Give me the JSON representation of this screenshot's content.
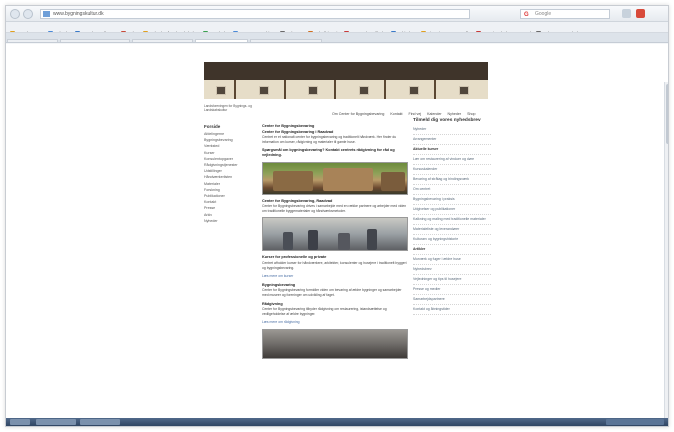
{
  "browser": {
    "url": "www.bygningskultur.dk",
    "search_placeholder": "Google",
    "search_logo": "G"
  },
  "bookmarks": [
    {
      "label": "Mest besøgte",
      "color": "#e0a020"
    },
    {
      "label": "Nyheder",
      "color": "#4a8ad8"
    },
    {
      "label": "Danske-ordbøger",
      "color": "#3a7ac8"
    },
    {
      "label": "Kultur",
      "color": "#c84a3a"
    },
    {
      "label": "Nyheder fra dansk kultur",
      "color": "#e0a020"
    },
    {
      "label": "Bornholm",
      "color": "#3aa050"
    },
    {
      "label": "Museer og Arkiver",
      "color": "#4a8ad8"
    },
    {
      "label": "Kulturarv",
      "color": "#6a6a6a"
    },
    {
      "label": "Lokalhistorie",
      "color": "#d07020"
    },
    {
      "label": "Danmarks Billeder",
      "color": "#c83a3a"
    },
    {
      "label": "Arkitektur",
      "color": "#3a7ac8"
    },
    {
      "label": "Historie og Fotografier",
      "color": "#e0a020"
    },
    {
      "label": "Bygningskultur Danmark",
      "color": "#c83a3a"
    },
    {
      "label": "Kulturarv Bornholm",
      "color": "#6a6a6a"
    }
  ],
  "tabs": [
    {
      "label": "Bornholm - opslag - ..."
    },
    {
      "label": "Museumsbesøg - Bornholm - ..."
    },
    {
      "label": "Bygger - BBI - Tidsskrift - ..."
    },
    {
      "label": "Bygningskultur - BBI ..."
    },
    {
      "label": "Bygningsbevaring - Realdania ..."
    }
  ],
  "site": {
    "logo_text": "Landsforeningen for Bygnings- og Landskabskultur",
    "topnav": [
      "Om Center for Bygningsbevaring",
      "Kontakt",
      "Find vej",
      "Kalender",
      "Nyheder",
      "Shop"
    ],
    "leftnav_heading": "Forside",
    "leftnav": [
      "Afdelingerne",
      "Bygningsbevaring",
      "Værksted",
      "Kurser",
      "Konsulentopgaver",
      "Rådgivningstjenester",
      "Udstillinger",
      "Håndværkerlisten",
      "Materialer",
      "Forskning",
      "Publikationer",
      "Kontakt",
      "Presse",
      "Arkiv",
      "Nyheder"
    ],
    "main": {
      "page_heading": "Center for Bygningsbevaring",
      "intro_heading": "Center for Bygningsbevaring i Raadvad",
      "intro_text": "Centret er et nationalt center for bygningsbevaring og traditionelt håndværk. Her finder du information om kurser, rådgivning og materialer til gamle huse.",
      "highlight_text": "Spørgsmål om bygningsbevaring? Kontakt centrets rådgivning for råd og vejledning.",
      "section1_heading": "Center for Bygningsbevaring, Raadvad",
      "section1_text": "Center for Bygningsbevaring drives i samarbejde med en række partnere og arbejder med viden om traditionelle byggematerialer og håndværksmetoder.",
      "section2_heading": "Kurser for professionelle og private",
      "section2_text": "Centret afholder kurser for håndværkere, arkitekter, konsulenter og husejere i traditionelt byggeri og bygningsbevaring.",
      "section2_link": "Læs mere om kurser",
      "section3_heading": "Bygningsbevaring",
      "section3_text": "Center for Bygningsbevaring formidler viden om bevaring af ældre bygninger og samarbejder med museer og foreninger om udvikling af faget.",
      "section4_heading": "Rådgivning",
      "section4_text": "Center for Bygningsbevaring tilbyder rådgivning om restaurering, istandsættelse og vedligeholdelse af ældre bygninger.",
      "section4_link": "Læs mere om rådgivning"
    },
    "sidebar_heading": "Tilmeld dig vores nyhedsbrev",
    "sidebar": [
      {
        "label": "Nyheder",
        "bold": false
      },
      {
        "label": "Arrangementer",
        "bold": false
      },
      {
        "label": "Aktuelle kurser",
        "bold": true
      },
      {
        "label": "Lær om restaurering af vinduer og døre",
        "bold": false
      },
      {
        "label": "Kursuskalender",
        "bold": false
      },
      {
        "label": "Bevaring af stråtag og bindingsværk",
        "bold": false
      },
      {
        "label": "Om centret",
        "bold": false
      },
      {
        "label": "Bygningsbevaring i praksis",
        "bold": false
      },
      {
        "label": "Udgivelser og publikationer",
        "bold": false
      },
      {
        "label": "Kalkning og maling med traditionelle materialer",
        "bold": false
      },
      {
        "label": "Materialeliste og leverandører",
        "bold": false
      },
      {
        "label": "Kulturarv og bygningshistorie",
        "bold": false
      },
      {
        "label": "Artikler",
        "bold": true
      },
      {
        "label": "Murværk og fuger i ældre huse",
        "bold": false
      },
      {
        "label": "Nyhedsbrev",
        "bold": false
      },
      {
        "label": "Vejledninger og tips til husejere",
        "bold": false
      },
      {
        "label": "Presse og medier",
        "bold": false
      },
      {
        "label": "Samarbejdspartnere",
        "bold": false
      },
      {
        "label": "Kontakt og åbningstider",
        "bold": false
      }
    ]
  }
}
